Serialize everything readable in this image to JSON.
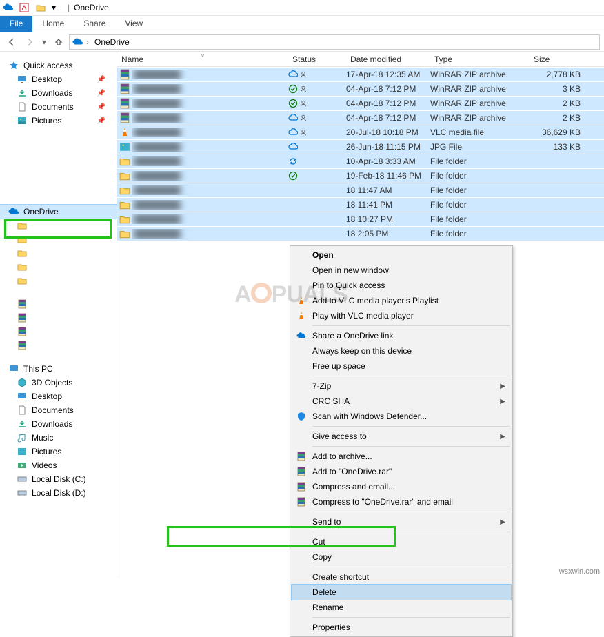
{
  "titlebar": {
    "title": "OneDrive",
    "separator": "|"
  },
  "ribbon": {
    "file": "File",
    "tabs": [
      "Home",
      "Share",
      "View"
    ]
  },
  "breadcrumb": {
    "items": [
      "OneDrive"
    ],
    "arrow": "›"
  },
  "sidebar": {
    "quick_access": {
      "label": "Quick access"
    },
    "quick_items": [
      {
        "label": "Desktop",
        "pin": true
      },
      {
        "label": "Downloads",
        "pin": true
      },
      {
        "label": "Documents",
        "pin": true
      },
      {
        "label": "Pictures",
        "pin": true
      }
    ],
    "onedrive": {
      "label": "OneDrive"
    },
    "this_pc": {
      "label": "This PC"
    },
    "pc_items": [
      {
        "label": "3D Objects"
      },
      {
        "label": "Desktop"
      },
      {
        "label": "Documents"
      },
      {
        "label": "Downloads"
      },
      {
        "label": "Music"
      },
      {
        "label": "Pictures"
      },
      {
        "label": "Videos"
      },
      {
        "label": "Local Disk (C:)"
      },
      {
        "label": "Local Disk (D:)"
      }
    ]
  },
  "columns": {
    "name": "Name",
    "status": "Status",
    "date": "Date modified",
    "type": "Type",
    "size": "Size"
  },
  "rows": [
    {
      "status_icon": "cloud",
      "person": true,
      "date": "17-Apr-18 12:35 AM",
      "type": "WinRAR ZIP archive",
      "size": "2,778 KB",
      "icon": "rar"
    },
    {
      "status_icon": "check",
      "person": true,
      "date": "04-Apr-18 7:12 PM",
      "type": "WinRAR ZIP archive",
      "size": "3 KB",
      "icon": "rar"
    },
    {
      "status_icon": "check",
      "person": true,
      "date": "04-Apr-18 7:12 PM",
      "type": "WinRAR ZIP archive",
      "size": "2 KB",
      "icon": "rar"
    },
    {
      "status_icon": "cloud",
      "person": true,
      "date": "04-Apr-18 7:12 PM",
      "type": "WinRAR ZIP archive",
      "size": "2 KB",
      "icon": "rar"
    },
    {
      "status_icon": "cloud",
      "person": true,
      "date": "20-Jul-18 10:18 PM",
      "type": "VLC media file",
      "size": "36,629 KB",
      "icon": "vlc"
    },
    {
      "status_icon": "cloud",
      "person": false,
      "date": "26-Jun-18 11:15 PM",
      "type": "JPG File",
      "size": "133 KB",
      "icon": "img"
    },
    {
      "status_icon": "sync",
      "person": false,
      "date": "10-Apr-18 3:33 AM",
      "type": "File folder",
      "size": "",
      "icon": "folder"
    },
    {
      "status_icon": "check",
      "person": false,
      "date": "19-Feb-18 11:46 PM",
      "type": "File folder",
      "size": "",
      "icon": "folder"
    },
    {
      "status_icon": "",
      "person": false,
      "date": "18 11:47 AM",
      "type": "File folder",
      "size": "",
      "icon": "folder"
    },
    {
      "status_icon": "",
      "person": false,
      "date": "18 11:41 PM",
      "type": "File folder",
      "size": "",
      "icon": "folder"
    },
    {
      "status_icon": "",
      "person": false,
      "date": "18 10:27 PM",
      "type": "File folder",
      "size": "",
      "icon": "folder"
    },
    {
      "status_icon": "",
      "person": false,
      "date": "18 2:05 PM",
      "type": "File folder",
      "size": "",
      "icon": "folder"
    }
  ],
  "context_menu": {
    "open": "Open",
    "open_new": "Open in new window",
    "pin_qa": "Pin to Quick access",
    "vlc_playlist": "Add to VLC media player's Playlist",
    "vlc_play": "Play with VLC media player",
    "share_od": "Share a OneDrive link",
    "keep_device": "Always keep on this device",
    "free_up": "Free up space",
    "sevenzip": "7-Zip",
    "crc": "CRC SHA",
    "defender": "Scan with Windows Defender...",
    "give_access": "Give access to",
    "add_archive": "Add to archive...",
    "add_to_rar": "Add to \"OneDrive.rar\"",
    "compress_email": "Compress and email...",
    "compress_to_email": "Compress to \"OneDrive.rar\" and email",
    "send_to": "Send to",
    "cut": "Cut",
    "copy": "Copy",
    "create_shortcut": "Create shortcut",
    "delete": "Delete",
    "rename": "Rename",
    "properties": "Properties"
  },
  "watermark": "wsxwin.com"
}
